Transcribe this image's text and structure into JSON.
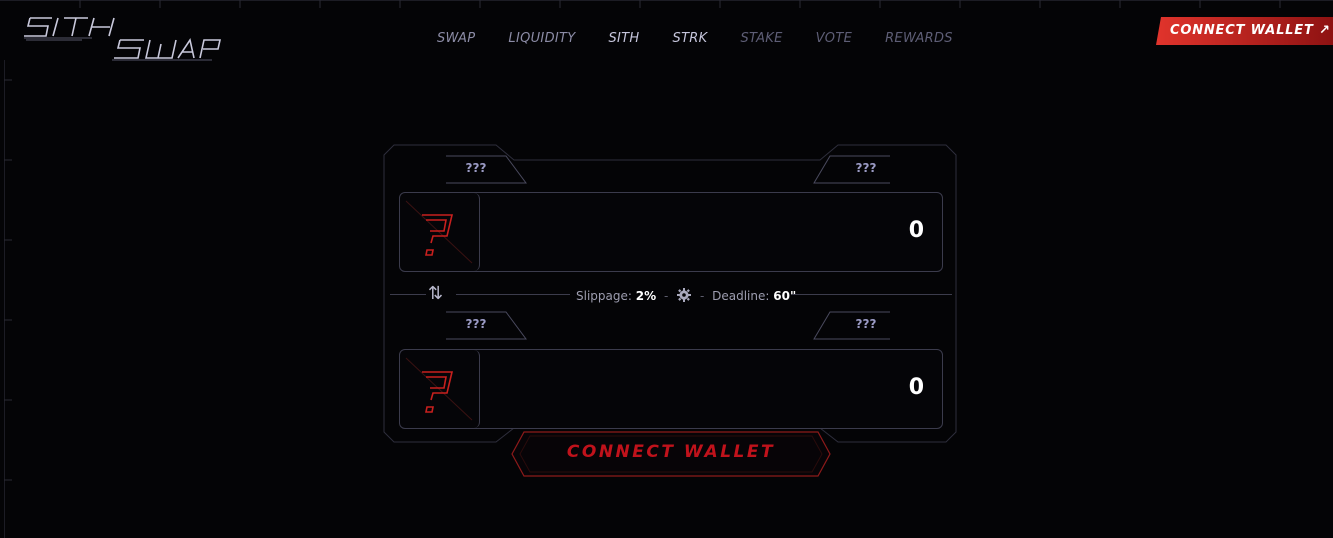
{
  "nav": {
    "items": [
      {
        "label": "SWAP"
      },
      {
        "label": "LIQUIDITY"
      },
      {
        "label": "SITH"
      },
      {
        "label": "STRK"
      },
      {
        "label": "STAKE"
      },
      {
        "label": "VOTE"
      },
      {
        "label": "REWARDS"
      }
    ]
  },
  "header": {
    "connect_label": "CONNECT WALLET ↗"
  },
  "swap": {
    "from": {
      "token_left": "???",
      "token_right": "???",
      "amount": "0"
    },
    "to": {
      "token_left": "???",
      "token_right": "???",
      "amount": "0"
    },
    "slippage_label": "Slippage:",
    "slippage_value": "2%",
    "deadline_label": "Deadline:",
    "deadline_value": "60\"",
    "connect_label": "CONNECT WALLET"
  },
  "colors": {
    "accent_red": "#d42a2a",
    "background": "#040406",
    "frame": "#3b3b4c"
  }
}
